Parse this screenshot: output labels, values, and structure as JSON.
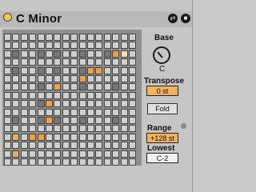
{
  "header": {
    "title": "C Minor",
    "buttons": [
      {
        "name": "preset-swap-icon",
        "glyph": "⇄"
      },
      {
        "name": "save-icon",
        "glyph": "■"
      }
    ]
  },
  "grid": {
    "cols": 16,
    "rows": 16,
    "values": [
      "0000000000000000",
      "0000000000000000",
      "0100101001001230",
      "0000000000000000",
      "0100101001220000",
      "0000000002000000",
      "0000102001000100",
      "0000000000000000",
      "0000120000000000",
      "0000000000000000",
      "0100121001000100",
      "0000000000000000",
      "0402200000000000",
      "0000000000000000",
      "0400000000000000",
      "0000000000000000"
    ]
  },
  "controls": {
    "base_label": "Base",
    "base_value": "C",
    "transpose_label": "Transpose",
    "transpose_value": "0 st",
    "fold_label": "Fold",
    "range_label": "Range",
    "range_value": "+128 st",
    "lowest_label": "Lowest",
    "lowest_value": "C-2"
  },
  "colors": {
    "active": "#f0a040",
    "highlight": "#f4e0a0",
    "dark_cell": "#777777",
    "light_cell": "#d0d0d0"
  }
}
